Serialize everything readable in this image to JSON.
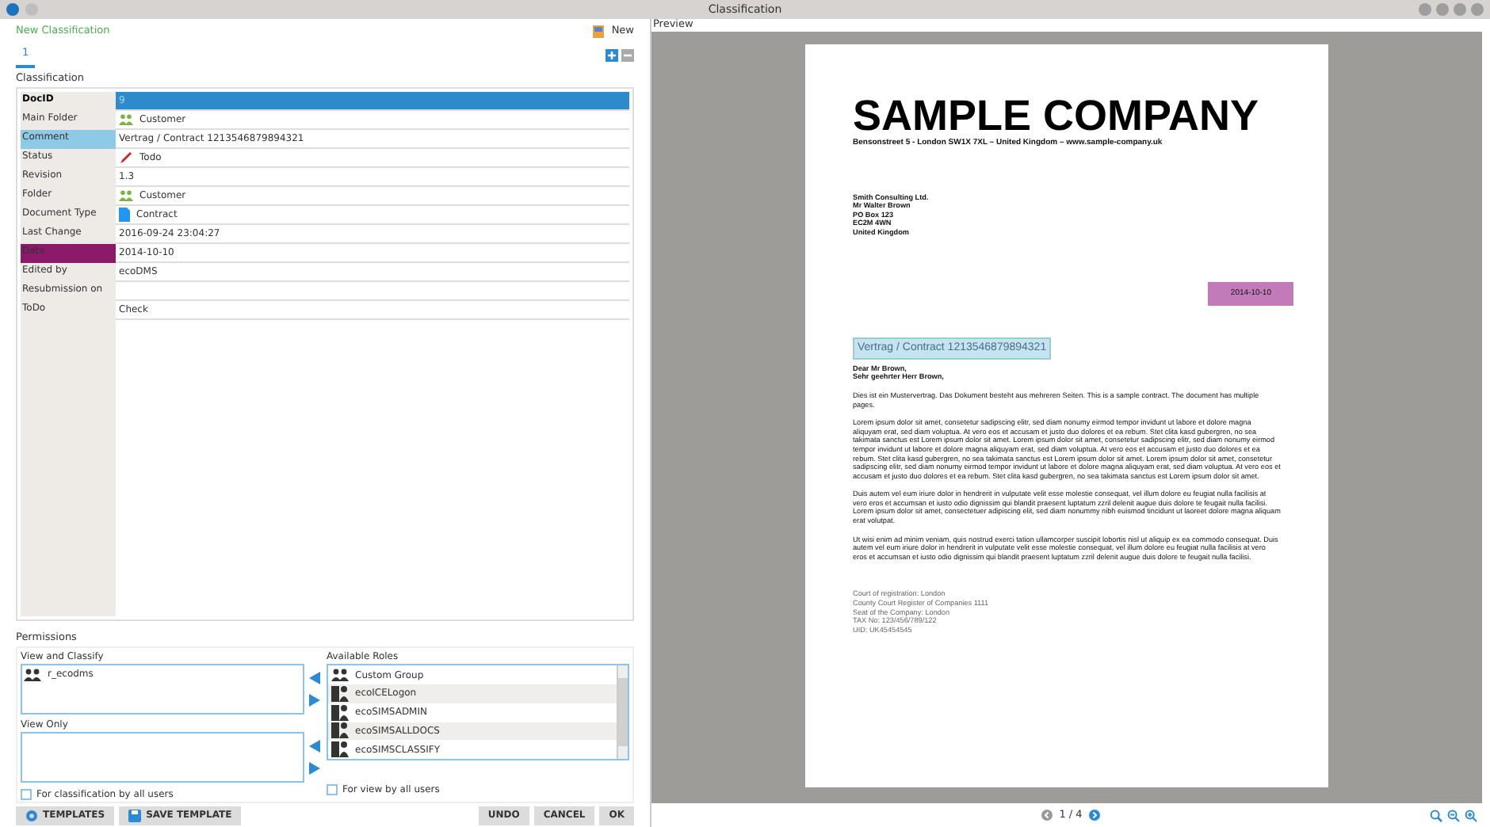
{
  "window": {
    "title": "Classification"
  },
  "header": {
    "title": "New Classification",
    "new_button": "New"
  },
  "tabs": [
    {
      "label": "1",
      "selected": true
    }
  ],
  "section_title": "Classification",
  "fields": [
    {
      "label": "DocID",
      "value": "9",
      "selected": true,
      "bold": true
    },
    {
      "label": "Main Folder",
      "value": "Customer",
      "kind": "group",
      "selected": false,
      "bold": false
    },
    {
      "label": "Comment",
      "value": "Vertrag / Contract 1213546879894321",
      "color": "#8ecae6",
      "selected": false,
      "bold": false
    },
    {
      "label": "Status",
      "value": "Todo",
      "kind": "pencil",
      "selected": false,
      "bold": false
    },
    {
      "label": "Revision",
      "value": "1.3",
      "selected": false,
      "bold": false
    },
    {
      "label": "Folder",
      "value": "Customer",
      "kind": "group",
      "selected": false,
      "bold": false
    },
    {
      "label": "Document Type",
      "value": "Contract",
      "kind": "document",
      "selected": false,
      "bold": false
    },
    {
      "label": "Last Change",
      "value": "2016-09-24 23:04:27",
      "selected": false,
      "bold": false
    },
    {
      "label": "Date",
      "value": "2014-10-10",
      "color": "#8b1a6b",
      "selected": false,
      "bold": false
    },
    {
      "label": "Edited by",
      "value": "ecoDMS",
      "selected": false,
      "bold": false
    },
    {
      "label": "Resubmission on",
      "selected": false,
      "bold": false
    },
    {
      "label": "ToDo",
      "value": "Check",
      "selected": false,
      "bold": false
    }
  ],
  "permissions": {
    "title": "Permissions",
    "view_and_classify": {
      "label": "View and Classify",
      "items": [
        {
          "name": "r_ecodms",
          "kind": "group"
        }
      ]
    },
    "view_only": {
      "label": "View Only"
    },
    "available_roles": {
      "label": "Available Roles",
      "items": [
        {
          "name": "Custom Group",
          "kind": "group"
        },
        {
          "name": "ecoICELogon",
          "kind": "role"
        },
        {
          "name": "ecoSIMSADMIN",
          "kind": "role"
        },
        {
          "name": "ecoSIMSALLDOCS",
          "kind": "role"
        },
        {
          "name": "ecoSIMSCLASSIFY",
          "kind": "role"
        }
      ]
    },
    "classification_all": {
      "label": "For classification by all users",
      "checked": false
    },
    "view_all": {
      "label": "For view by all users",
      "checked": false
    }
  },
  "footer_buttons": [
    {
      "label": "TEMPLATES",
      "kind": "gear"
    },
    {
      "label": "SAVE TEMPLATE",
      "kind": "save"
    }
  ],
  "action_buttons": [
    "UNDO",
    "CANCEL",
    "OK"
  ],
  "preview": {
    "title": "Preview",
    "pager": "1 / 4",
    "document": {
      "company": "SAMPLE COMPANY",
      "address": "Bensonstreet 5 -  London SW1X 7XL – United Kingdom – www.sample-company.uk",
      "recipient": [
        "Smith Consulting Ltd.",
        "Mr Walter Brown",
        "PO Box 123",
        "EC2M 4WN",
        "United Kingdom"
      ],
      "date": "2014-10-10",
      "subject": "Vertrag / Contract 1213546879894321",
      "salutation": [
        "Dear Mr Brown,",
        "Sehr geehrter Herr Brown,"
      ],
      "paragraphs": [
        "Dies ist ein Mustervertrag. Das Dokument besteht aus mehreren Seiten. This is a sample contract. The document has multiple pages.",
        "Lorem ipsum dolor sit amet, consetetur sadipscing elitr, sed diam nonumy eirmod tempor invidunt ut labore et dolore magna aliquyam erat, sed diam voluptua. At vero eos et accusam et justo duo dolores et ea rebum. Stet clita kasd gubergren, no sea takimata sanctus est Lorem ipsum dolor sit amet. Lorem ipsum dolor sit amet, consetetur sadipscing elitr, sed diam nonumy eirmod tempor invidunt ut labore et dolore magna aliquyam erat, sed diam voluptua. At vero eos et accusam et justo duo dolores et ea rebum. Stet clita kasd gubergren, no sea takimata sanctus est Lorem ipsum dolor sit amet. Lorem ipsum dolor sit amet, consetetur sadipscing elitr, sed diam nonumy eirmod tempor invidunt ut labore et dolore magna aliquyam erat, sed diam voluptua. At vero eos et accusam et justo duo dolores et ea rebum. Stet clita kasd gubergren, no sea takimata sanctus est Lorem ipsum dolor sit amet.",
        "Duis autem vel eum iriure dolor in hendrerit in vulputate velit esse molestie consequat, vel illum dolore eu feugiat nulla facilisis at vero eros et accumsan et iusto odio dignissim qui blandit praesent luptatum zzril delenit augue duis dolore te feugait nulla facilisi. Lorem ipsum dolor sit amet, consectetuer adipiscing elit, sed diam nonummy nibh euismod tincidunt ut laoreet dolore magna aliquam erat volutpat.",
        "Ut wisi enim ad minim veniam, quis nostrud exerci tation ullamcorper suscipit lobortis nisl ut aliquip ex ea commodo consequat. Duis autem vel eum iriure dolor in hendrerit in vulputate velit esse molestie consequat, vel illum dolore eu feugiat nulla facilisis at vero eros et accumsan et iusto odio dignissim qui blandit praesent luptatum zzril delenit augue duis dolore te feugait nulla facilisi."
      ],
      "footer": [
        "Court of registration: London",
        "County Court Register of Companies 1111",
        "Seat of the Company: London",
        "TAX No: 123/456/789/122",
        "UID: UK45454545"
      ]
    }
  }
}
